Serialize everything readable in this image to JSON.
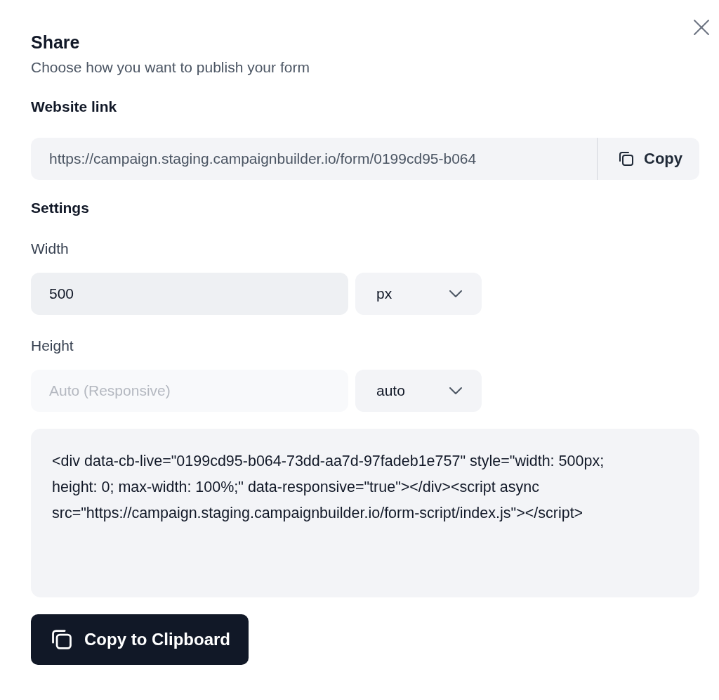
{
  "dialog": {
    "title": "Share",
    "subtitle": "Choose how you want to publish your form"
  },
  "website_link": {
    "label": "Website link",
    "value": "https://campaign.staging.campaignbuilder.io/form/0199cd95-b064",
    "copy_button": "Copy"
  },
  "settings": {
    "label": "Settings",
    "fields": [
      {
        "label": "Width",
        "value": "500",
        "unit": "px",
        "disabled": false
      },
      {
        "label": "Height",
        "placeholder": "Auto (Responsive)",
        "unit": "auto",
        "disabled": true
      }
    ]
  },
  "embed_code": "<div data-cb-live=\"0199cd95-b064-73dd-aa7d-97fadeb1e757\" style=\"width: 500px; height: 0; max-width: 100%;\" data-responsive=\"true\"></div><script async src=\"https://campaign.staging.campaignbuilder.io/form-script/index.js\"></script>",
  "copy_clipboard_button": "Copy to Clipboard"
}
